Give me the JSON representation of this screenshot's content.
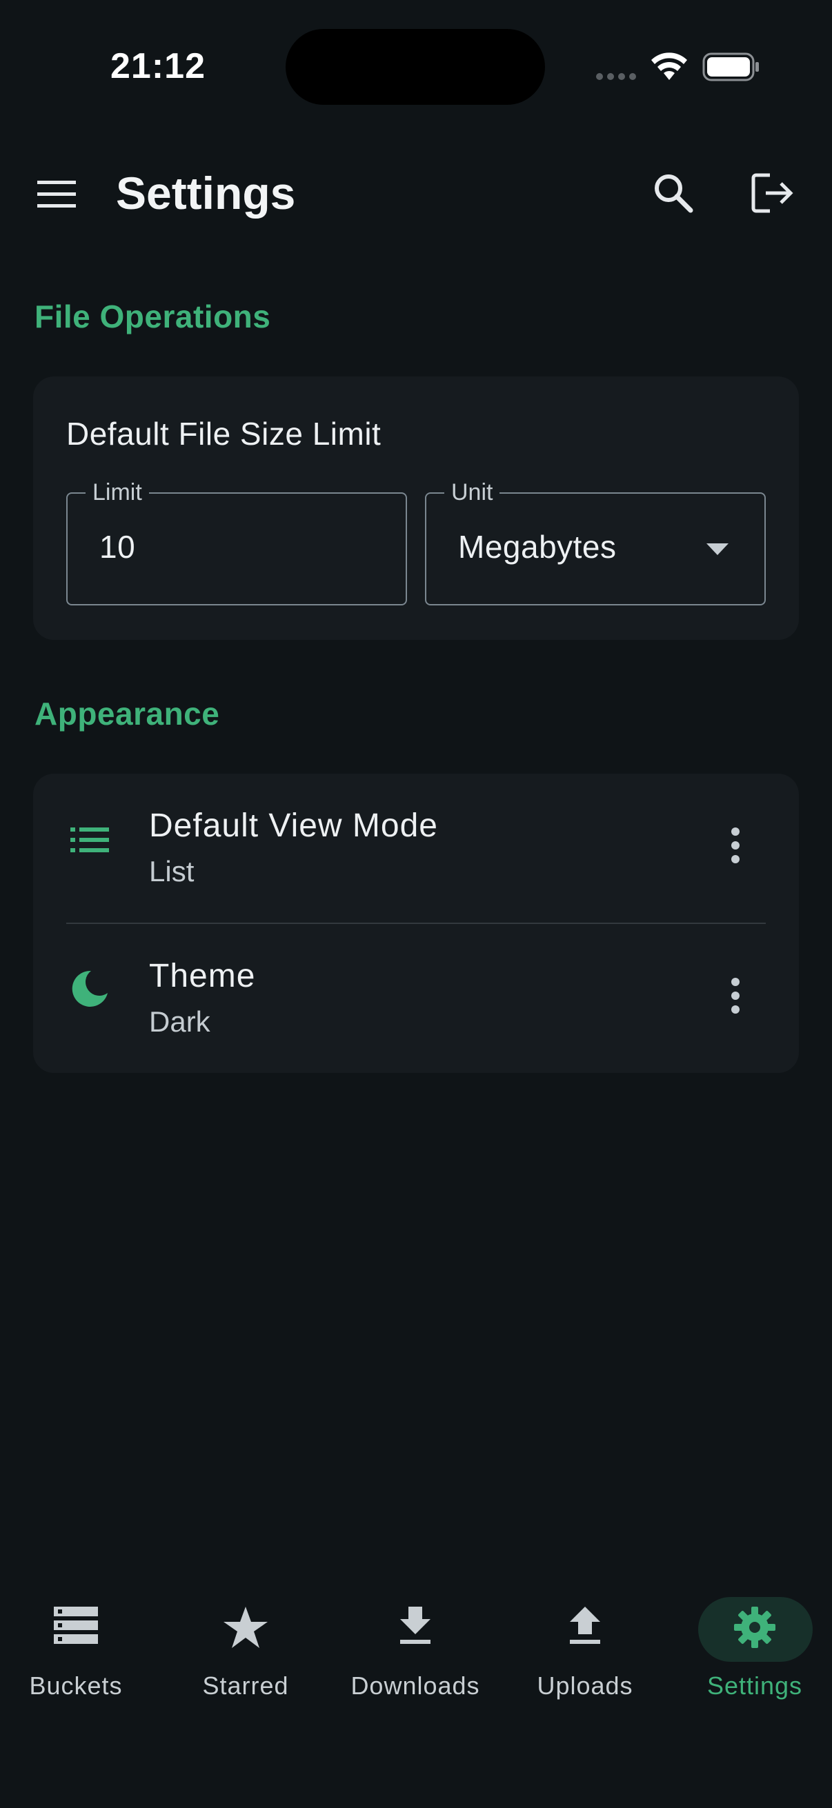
{
  "status_bar": {
    "time": "21:12"
  },
  "app_bar": {
    "title": "Settings"
  },
  "sections": {
    "file_operations": {
      "title": "File Operations",
      "card_label": "Default File Size Limit",
      "limit": {
        "legend": "Limit",
        "value": "10"
      },
      "unit": {
        "legend": "Unit",
        "value": "Megabytes"
      }
    },
    "appearance": {
      "title": "Appearance",
      "items": [
        {
          "title": "Default View Mode",
          "value": "List",
          "icon": "list-icon"
        },
        {
          "title": "Theme",
          "value": "Dark",
          "icon": "moon-icon"
        }
      ]
    }
  },
  "bottom_nav": {
    "items": [
      {
        "label": "Buckets",
        "icon": "storage-icon",
        "active": false
      },
      {
        "label": "Starred",
        "icon": "star-icon",
        "active": false
      },
      {
        "label": "Downloads",
        "icon": "download-icon",
        "active": false
      },
      {
        "label": "Uploads",
        "icon": "upload-icon",
        "active": false
      },
      {
        "label": "Settings",
        "icon": "gear-icon",
        "active": true
      }
    ]
  },
  "colors": {
    "background": "#0f1417",
    "card": "#161b1f",
    "accent": "#3fb27a",
    "active_pill": "#17302a"
  }
}
